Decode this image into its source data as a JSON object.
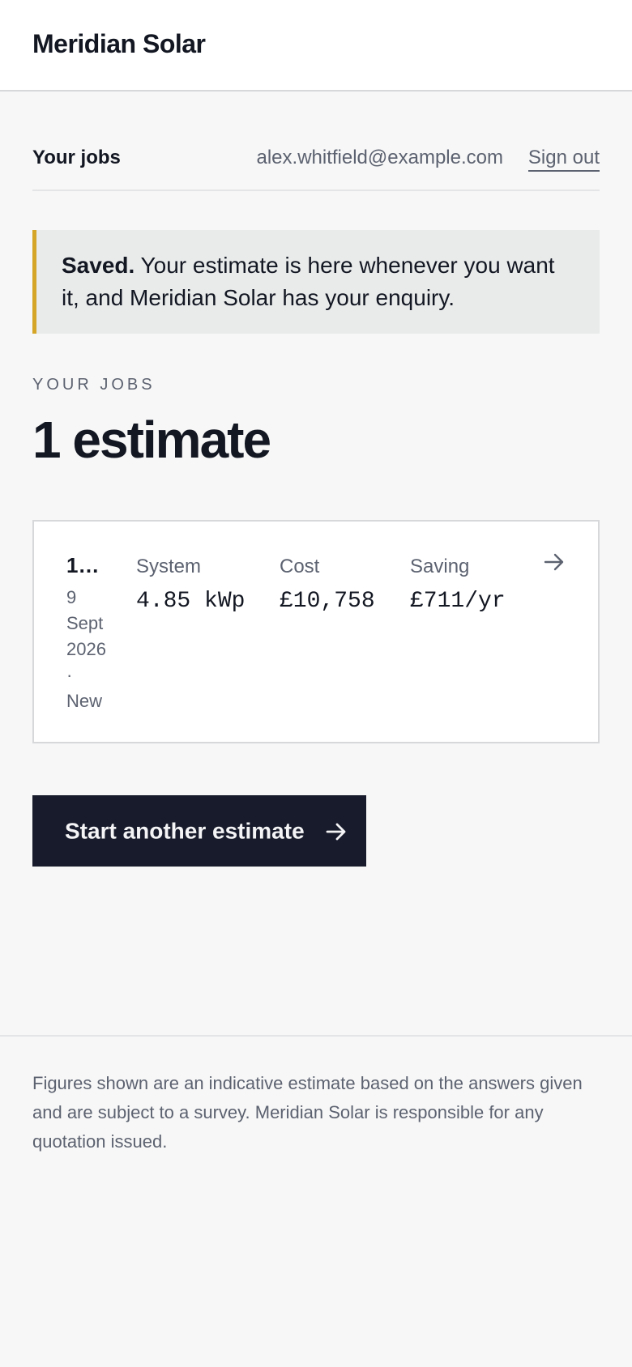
{
  "app": {
    "brand": "Meridian Solar"
  },
  "account": {
    "title": "Your jobs",
    "email": "alex.whitfield@example.com",
    "sign_out": "Sign out"
  },
  "notice": {
    "strong": "Saved.",
    "message": " Your estimate is here whenever you want it, and Meridian Solar has your enquiry.",
    "accent_color": "#d4a526"
  },
  "jobs": {
    "eyebrow": "YOUR JOBS",
    "title": "1 estimate",
    "items": [
      {
        "id": "1…",
        "date": "9 Sept 2026",
        "separator": "·",
        "status": "New",
        "system_label": "System",
        "system_value": "4.85 kWp",
        "cost_label": "Cost",
        "cost_value": "£10,758",
        "saving_label": "Saving",
        "saving_value": "£711/yr",
        "icon": "arrow-right-icon"
      }
    ]
  },
  "actions": {
    "start_another": "Start another estimate",
    "start_icon": "arrow-right-icon",
    "button_color": "#171b2b"
  },
  "footer": {
    "disclaimer": "Figures shown are an indicative estimate based on the answers given and are subject to a survey. Meridian Solar is responsible for any quotation issued."
  }
}
